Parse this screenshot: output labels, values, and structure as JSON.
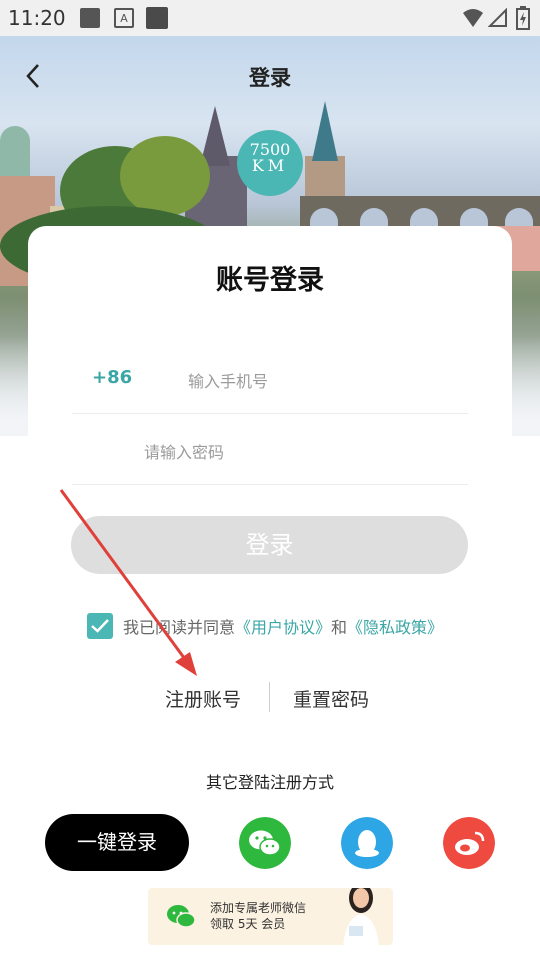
{
  "status_bar": {
    "time": "11:20"
  },
  "header": {
    "title": "登录"
  },
  "logo": {
    "line1": "7500",
    "line2": "KM"
  },
  "card": {
    "title": "账号登录",
    "country_code": "+86",
    "phone_placeholder": "输入手机号",
    "password_placeholder": "请输入密码"
  },
  "login_button": "登录",
  "agreement": {
    "text": "我已阅读并同意",
    "user_agreement": "《用户协议》",
    "and": "和",
    "privacy_policy": "《隐私政策》",
    "checked": true
  },
  "links": {
    "register": "注册账号",
    "reset_password": "重置密码"
  },
  "other_methods": {
    "label": "其它登陆注册方式",
    "one_key": "一键登录",
    "icons": [
      "wechat-icon",
      "qq-icon",
      "weibo-icon"
    ],
    "colors": {
      "wechat": "#2eb83e",
      "qq": "#2ea6e6",
      "weibo": "#ee4a3f"
    }
  },
  "banner": {
    "line1": "添加专属老师微信",
    "line2": "领取 5天 会员"
  },
  "colors": {
    "accent": "#4bb7b5",
    "button_disabled": "#dedede",
    "annotation_arrow": "#e0403a"
  }
}
